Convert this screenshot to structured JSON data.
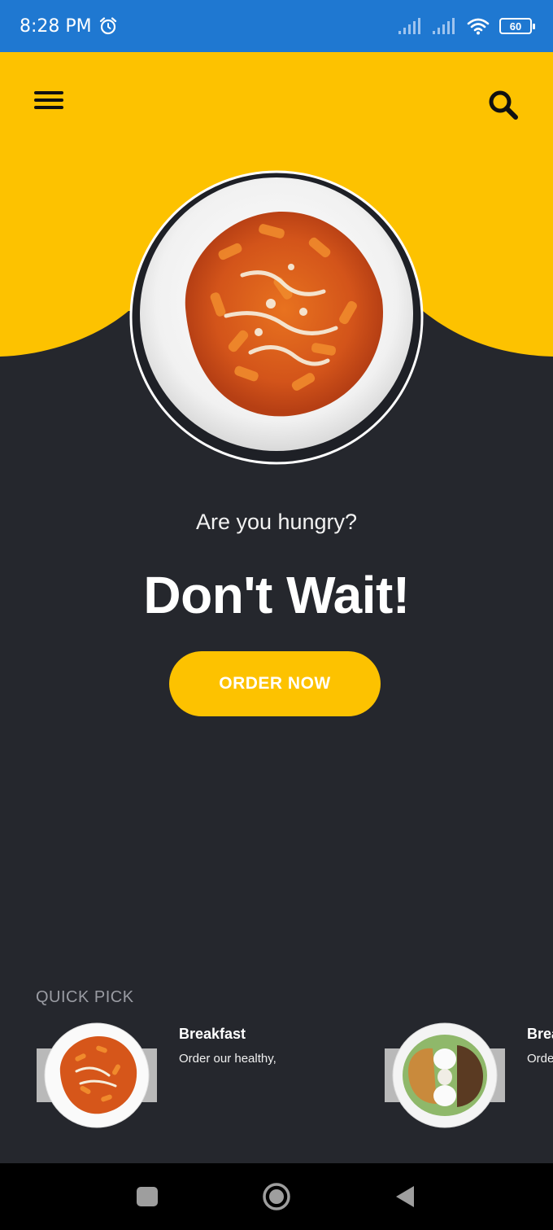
{
  "status_bar": {
    "time": "8:28 PM",
    "battery": "60",
    "icons": [
      "alarm-icon",
      "signal-icon",
      "signal-icon",
      "wifi-icon",
      "battery-icon"
    ]
  },
  "header": {
    "menu_icon": "hamburger-menu-icon",
    "search_icon": "search-icon",
    "accent_color": "#fdc200",
    "background_color": "#25272d"
  },
  "hero": {
    "subtitle": "Are you hungry?",
    "headline": "Don't Wait!",
    "cta_label": "ORDER NOW"
  },
  "quick_pick": {
    "title": "QUICK PICK",
    "items": [
      {
        "title": "Breakfast",
        "description": "Order our healthy,"
      },
      {
        "title": "Brea",
        "description": "Orde"
      }
    ]
  },
  "nav_bar": {
    "icons": [
      "recent-apps-icon",
      "home-icon",
      "back-icon"
    ]
  }
}
